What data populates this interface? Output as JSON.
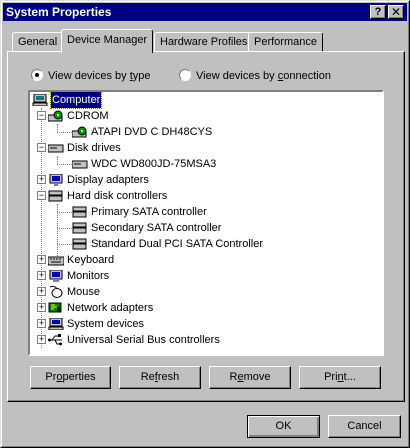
{
  "window": {
    "title": "System Properties",
    "help_glyph": "?",
    "close_glyph": "✕"
  },
  "tabs": [
    {
      "label": "General"
    },
    {
      "label": "Device Manager"
    },
    {
      "label": "Hardware Profiles"
    },
    {
      "label": "Performance"
    }
  ],
  "view_options": {
    "by_type": {
      "pre": "View devices by ",
      "key": "t",
      "post": "ype",
      "checked": true
    },
    "by_connection": {
      "pre": "View devices by ",
      "key": "c",
      "post": "onnection",
      "checked": false
    }
  },
  "tree": {
    "root": {
      "label": "Computer",
      "icon": "computer-icon"
    },
    "categories": [
      {
        "label": "CDROM",
        "icon": "cdrom-icon",
        "expanded": true,
        "children": [
          {
            "label": "ATAPI DVD C  DH48CYS",
            "icon": "cdrom-icon"
          }
        ]
      },
      {
        "label": "Disk drives",
        "icon": "disk-drive-icon",
        "expanded": true,
        "children": [
          {
            "label": "WDC WD800JD-75MSA3",
            "icon": "disk-drive-icon"
          }
        ]
      },
      {
        "label": "Display adapters",
        "icon": "display-adapter-icon",
        "expanded": false,
        "children": []
      },
      {
        "label": "Hard disk controllers",
        "icon": "hard-disk-controller-icon",
        "expanded": true,
        "children": [
          {
            "label": "Primary SATA controller",
            "icon": "hard-disk-controller-icon"
          },
          {
            "label": "Secondary SATA controller",
            "icon": "hard-disk-controller-icon"
          },
          {
            "label": "Standard Dual PCI SATA Controller",
            "icon": "hard-disk-controller-icon"
          }
        ]
      },
      {
        "label": "Keyboard",
        "icon": "keyboard-icon",
        "expanded": false,
        "children": []
      },
      {
        "label": "Monitors",
        "icon": "monitor-icon",
        "expanded": false,
        "children": []
      },
      {
        "label": "Mouse",
        "icon": "mouse-icon",
        "expanded": false,
        "children": []
      },
      {
        "label": "Network adapters",
        "icon": "network-adapter-icon",
        "expanded": false,
        "children": []
      },
      {
        "label": "System devices",
        "icon": "system-devices-icon",
        "expanded": false,
        "children": []
      },
      {
        "label": "Universal Serial Bus controllers",
        "icon": "usb-icon",
        "expanded": false,
        "children": []
      }
    ]
  },
  "actions": {
    "properties": {
      "key": "o",
      "pre": "Pr",
      "post": "perties"
    },
    "refresh": {
      "key": "f",
      "pre": "Re",
      "post": "resh"
    },
    "remove": {
      "key": "e",
      "pre": "R",
      "post": "move"
    },
    "print": {
      "key": "n",
      "pre": "Pri",
      "post": "t..."
    }
  },
  "dialog_buttons": {
    "ok": "OK",
    "cancel": "Cancel"
  },
  "colors": {
    "title_bar": "#000080",
    "face": "#c0c0c0",
    "selection": "#000080"
  }
}
